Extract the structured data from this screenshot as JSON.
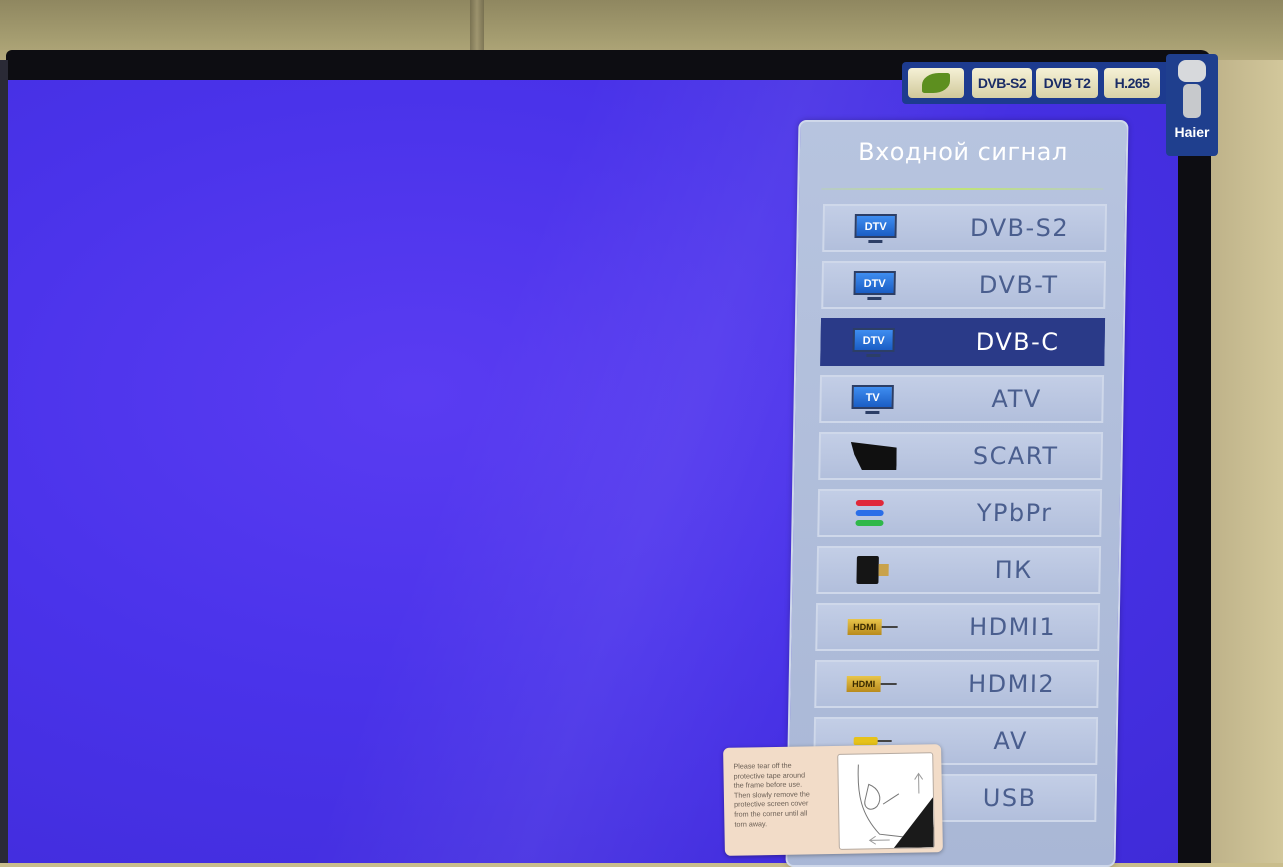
{
  "badges": {
    "leaf_icon": "leaf-icon",
    "dvbs2": "DVB-S2",
    "dvbt2": "DVB T2",
    "h265": "H.265"
  },
  "brand": {
    "name": "Haier",
    "mascot_icon": "robot-mascot-icon"
  },
  "panel": {
    "title": "Входной сигнал",
    "selected_index": 2,
    "items": [
      {
        "label": "DVB-S2",
        "icon": "dtv-icon",
        "icon_text": "DTV"
      },
      {
        "label": "DVB-T",
        "icon": "dtv-icon",
        "icon_text": "DTV"
      },
      {
        "label": "DVB-C",
        "icon": "dtv-icon",
        "icon_text": "DTV"
      },
      {
        "label": "ATV",
        "icon": "tv-icon",
        "icon_text": "TV"
      },
      {
        "label": "SCART",
        "icon": "scart-icon",
        "icon_text": ""
      },
      {
        "label": "YPbPr",
        "icon": "component-cable-icon",
        "icon_text": ""
      },
      {
        "label": "ПК",
        "icon": "vga-icon",
        "icon_text": ""
      },
      {
        "label": "HDMI1",
        "icon": "hdmi-icon",
        "icon_text": "HDMI"
      },
      {
        "label": "HDMI2",
        "icon": "hdmi-icon",
        "icon_text": "HDMI"
      },
      {
        "label": "AV",
        "icon": "av-cable-icon",
        "icon_text": ""
      },
      {
        "label": "USB",
        "icon": "usb-icon",
        "icon_text": ""
      }
    ]
  },
  "sticker": {
    "text": "Please tear off the\nprotective tape around\nthe frame before use.\nThen slowly remove the\nprotective screen cover\nfrom the corner until all\ntorn away."
  },
  "colors": {
    "screen": "#4a33ea",
    "panel": "#b7c4df",
    "selected_item": "#2a3a88",
    "item_text": "#4a5e8e"
  }
}
